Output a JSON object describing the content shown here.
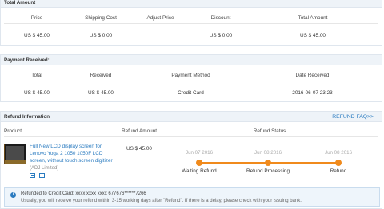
{
  "total_amount": {
    "title": "Total Amount",
    "headers": [
      "Price",
      "Shipping Cost",
      "Adjust Price",
      "Discount",
      "Total Amount"
    ],
    "values": [
      "US $ 45.00",
      "US $ 0.00",
      "",
      "US $ 0.00",
      "US $ 45.00"
    ]
  },
  "payment_received": {
    "title": "Payment Received:",
    "headers": [
      "Total",
      "Received",
      "Payment Method",
      "Date Received"
    ],
    "values": [
      "US $ 45.00",
      "US $ 45.00",
      "Credit Card",
      "2016-06-07 23:23"
    ]
  },
  "refund": {
    "title": "Refund Information",
    "faq_link": "REFUND FAQ>>",
    "headers": [
      "Product",
      "Refund Amount",
      "Refund Status"
    ],
    "product_title": "Full New LCD display screen for Lenovo Yoga 2 1050 1050F LCD screen, without touch screen digitizer",
    "shop": "(ADJ Limited)",
    "amount": "US $ 45.00",
    "steps": [
      {
        "date": "Jun 07 2016",
        "label": "Waiting Refund"
      },
      {
        "date": "Jun 08 2016",
        "label": "Refund Processing"
      },
      {
        "date": "Jun 08 2016",
        "label": "Refund"
      }
    ],
    "notice_line1": "Refunded to Credit Card: xxxx xxxx xxxx 677676******7266",
    "notice_line2": "Usually, you will receive your refund within 3-15 working days after \"Refund\". If there is a delay, please check with your issuing bank."
  },
  "colors": {
    "accent": "#2a7bc0",
    "progress": "#f08a1c"
  }
}
